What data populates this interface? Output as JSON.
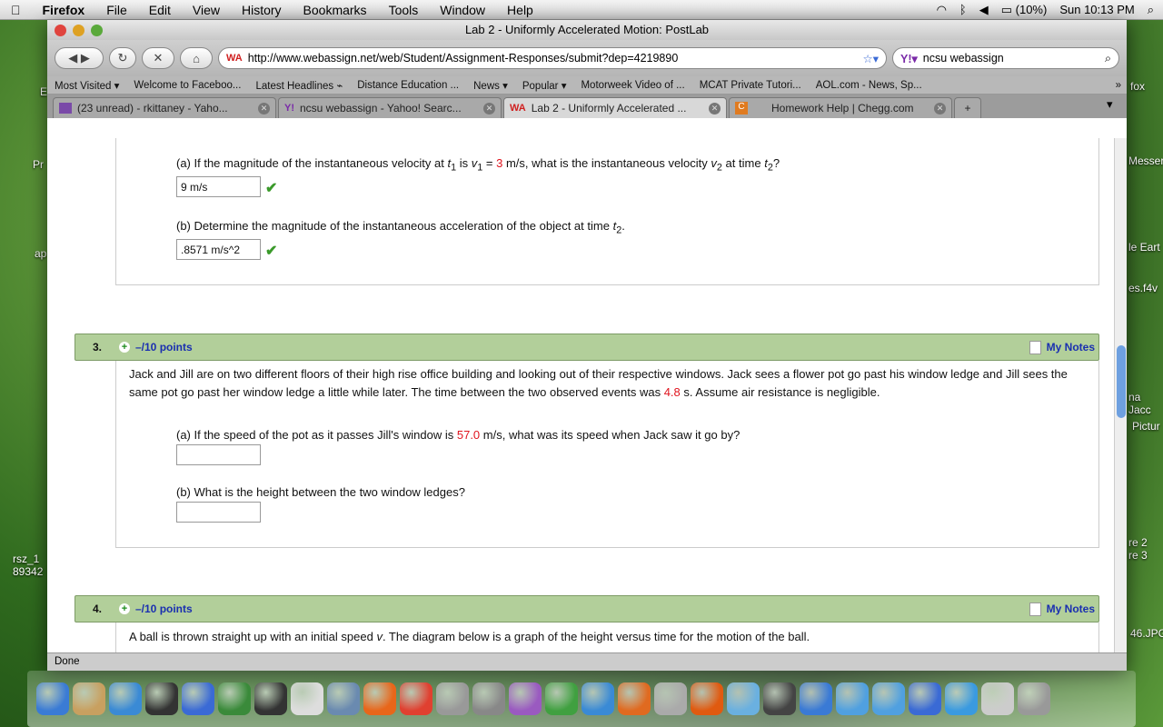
{
  "menubar": {
    "app": "Firefox",
    "items": [
      "File",
      "Edit",
      "View",
      "History",
      "Bookmarks",
      "Tools",
      "Window",
      "Help"
    ],
    "battery": "(10%)",
    "clock": "Sun 10:13 PM"
  },
  "desktop": {
    "left_labels": [
      "Pr",
      "ap",
      "rsz_1\n89342",
      "E"
    ],
    "right_labels": [
      "Messer",
      "le Eart",
      "es.f4v",
      "na Jacc",
      "Pictur",
      "re 2\nre 3",
      "46.JPG",
      "fox"
    ]
  },
  "window": {
    "title": "Lab 2 - Uniformly Accelerated Motion: PostLab"
  },
  "toolbar": {
    "url": "http://www.webassign.net/web/Student/Assignment-Responses/submit?dep=4219890",
    "search": "ncsu webassign"
  },
  "bookmarks": [
    "Most Visited ▾",
    "Welcome to Faceboo...",
    "Latest Headlines ⌁",
    "Distance Education ...",
    "News ▾",
    "Popular ▾",
    "Motorweek Video of ...",
    "MCAT Private Tutori...",
    "AOL.com - News, Sp..."
  ],
  "tabs": [
    {
      "label": "(23 unread) - rkittaney - Yaho...",
      "icon": "mail-icon",
      "color": "#7a4aa8"
    },
    {
      "label": "ncsu webassign - Yahoo! Searc...",
      "icon": "yahoo-icon",
      "color": "#7a2aa8"
    },
    {
      "label": "Lab 2 - Uniformly Accelerated ...",
      "icon": "webassign-icon",
      "color": "#d02020",
      "active": true
    },
    {
      "label": "Homework Help | Chegg.com",
      "icon": "chegg-icon",
      "color": "#e07b20"
    }
  ],
  "q2": {
    "a_pre": "(a) If the magnitude of the instantaneous velocity at ",
    "a_t1": "t",
    "a_sub1": "1",
    "a_mid": " is ",
    "a_v1": "v",
    "a_sub2": "1",
    "a_eq": " = ",
    "a_val": "3",
    "a_post": " m/s, what is the instantaneous velocity ",
    "a_v2": "v",
    "a_sub3": "2",
    "a_at": " at time ",
    "a_t2": "t",
    "a_sub4": "2",
    "a_q": "?",
    "a_answer": "9 m/s",
    "b_text": "(b) Determine the magnitude of the instantaneous acceleration of the object at time ",
    "b_t": "t",
    "b_sub": "2",
    "b_end": ".",
    "b_answer": ".8571 m/s^2"
  },
  "q3": {
    "num": "3.",
    "points": "–/10 points",
    "notes": "My Notes",
    "body1": "Jack and Jill are on two different floors of their high rise office building and looking out of their respective windows. Jack sees a flower pot go past his window ledge and Jill sees the same pot go past her window ledge a little while later. The time between the two observed events was ",
    "time": "4.8",
    "body2": " s. Assume air resistance is negligible.",
    "a_pre": "(a) If the speed of the pot as it passes Jill's window is ",
    "a_val": "57.0",
    "a_post": " m/s, what was its speed when Jack saw it go by?",
    "b": "(b) What is the height between the two window ledges?",
    "a_answer": "",
    "b_answer": ""
  },
  "q4": {
    "num": "4.",
    "points": "–/10 points",
    "notes": "My Notes",
    "body_pre": "A ball is thrown straight up with an initial speed ",
    "body_v": "v",
    "body_post": ". The diagram below is a graph of the height versus time for the motion of the ball."
  },
  "status": "Done",
  "dock_colors": [
    "#3a7bd5",
    "#c8a060",
    "#3a8ad5",
    "#333",
    "#3a6ad5",
    "#3a8a3a",
    "#333",
    "#ddd",
    "#6a8ab0",
    "#e8661a",
    "#e04030",
    "#999",
    "#888",
    "#9a5ac0",
    "#40a040",
    "#3a8ad5",
    "#e06a20",
    "#aaa",
    "#e05a10",
    "#6ab0e0",
    "#444",
    "#3a7ad5",
    "#50a0e0",
    "#50a0e0",
    "#3a6ad5",
    "#3a9ae0",
    "#ccc",
    "#999"
  ]
}
